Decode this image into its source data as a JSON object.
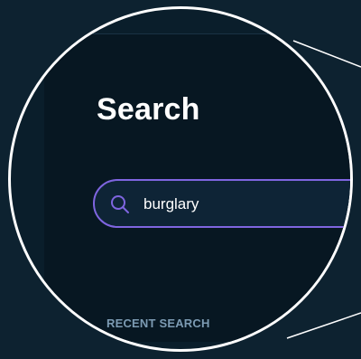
{
  "header": {
    "title": "Search"
  },
  "search": {
    "value": "burglary",
    "icon": "search-icon"
  },
  "recent": {
    "label": "RECENT SEARCH"
  },
  "colors": {
    "background": "#0d2230",
    "panel": "#071722",
    "accent": "#7f65e0",
    "text": "#ffffff",
    "muted": "#7c9bb3"
  }
}
